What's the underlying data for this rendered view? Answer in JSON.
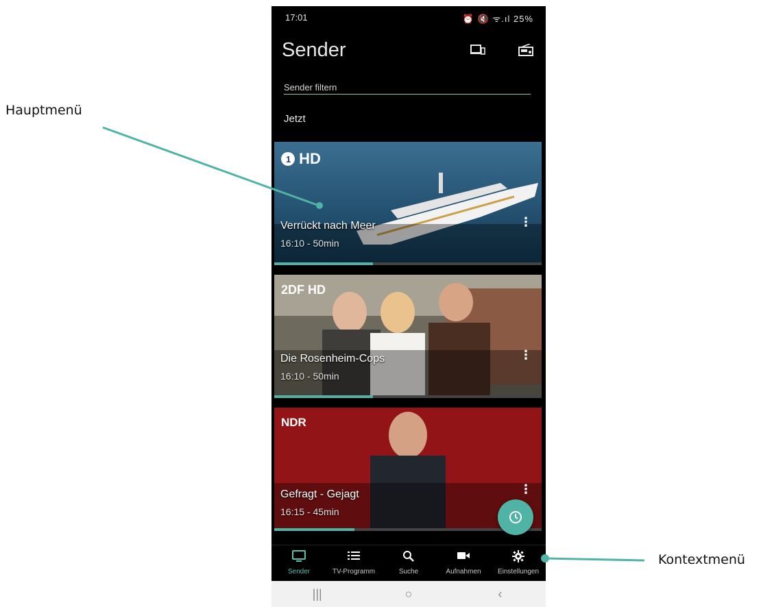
{
  "annotations": {
    "main_menu_label": "Hauptmenü",
    "context_menu_label": "Kontextmenü",
    "line_color": "#4fb3a5"
  },
  "status_bar": {
    "time": "17:01",
    "indicators": "⏰ 🔇 ᯤ.ıl 25%"
  },
  "header": {
    "title": "Sender",
    "icons": [
      "devices-icon",
      "radio-icon"
    ]
  },
  "filter": {
    "placeholder": "Sender filtern"
  },
  "section": {
    "title": "Jetzt"
  },
  "cards": [
    {
      "logo": "HD",
      "title": "Verrückt nach Meer",
      "time": "16:10 - 50min",
      "progress": 0.37
    },
    {
      "logo": "2DF HD",
      "title": "Die Rosenheim-Cops",
      "time": "16:10 - 50min",
      "progress": 0.37
    },
    {
      "logo": "NDR",
      "title": "Gefragt - Gejagt",
      "time": "16:15 - 45min",
      "progress": 0.3
    }
  ],
  "bottom_nav": {
    "items": [
      {
        "label": "Sender",
        "icon": "tv-icon",
        "active": true
      },
      {
        "label": "TV-Programm",
        "icon": "list-icon"
      },
      {
        "label": "Suche",
        "icon": "search-icon"
      },
      {
        "label": "Aufnahmen",
        "icon": "camera-icon"
      },
      {
        "label": "Einstellungen",
        "icon": "gear-icon"
      }
    ]
  },
  "accent_color": "#4fb3a5"
}
